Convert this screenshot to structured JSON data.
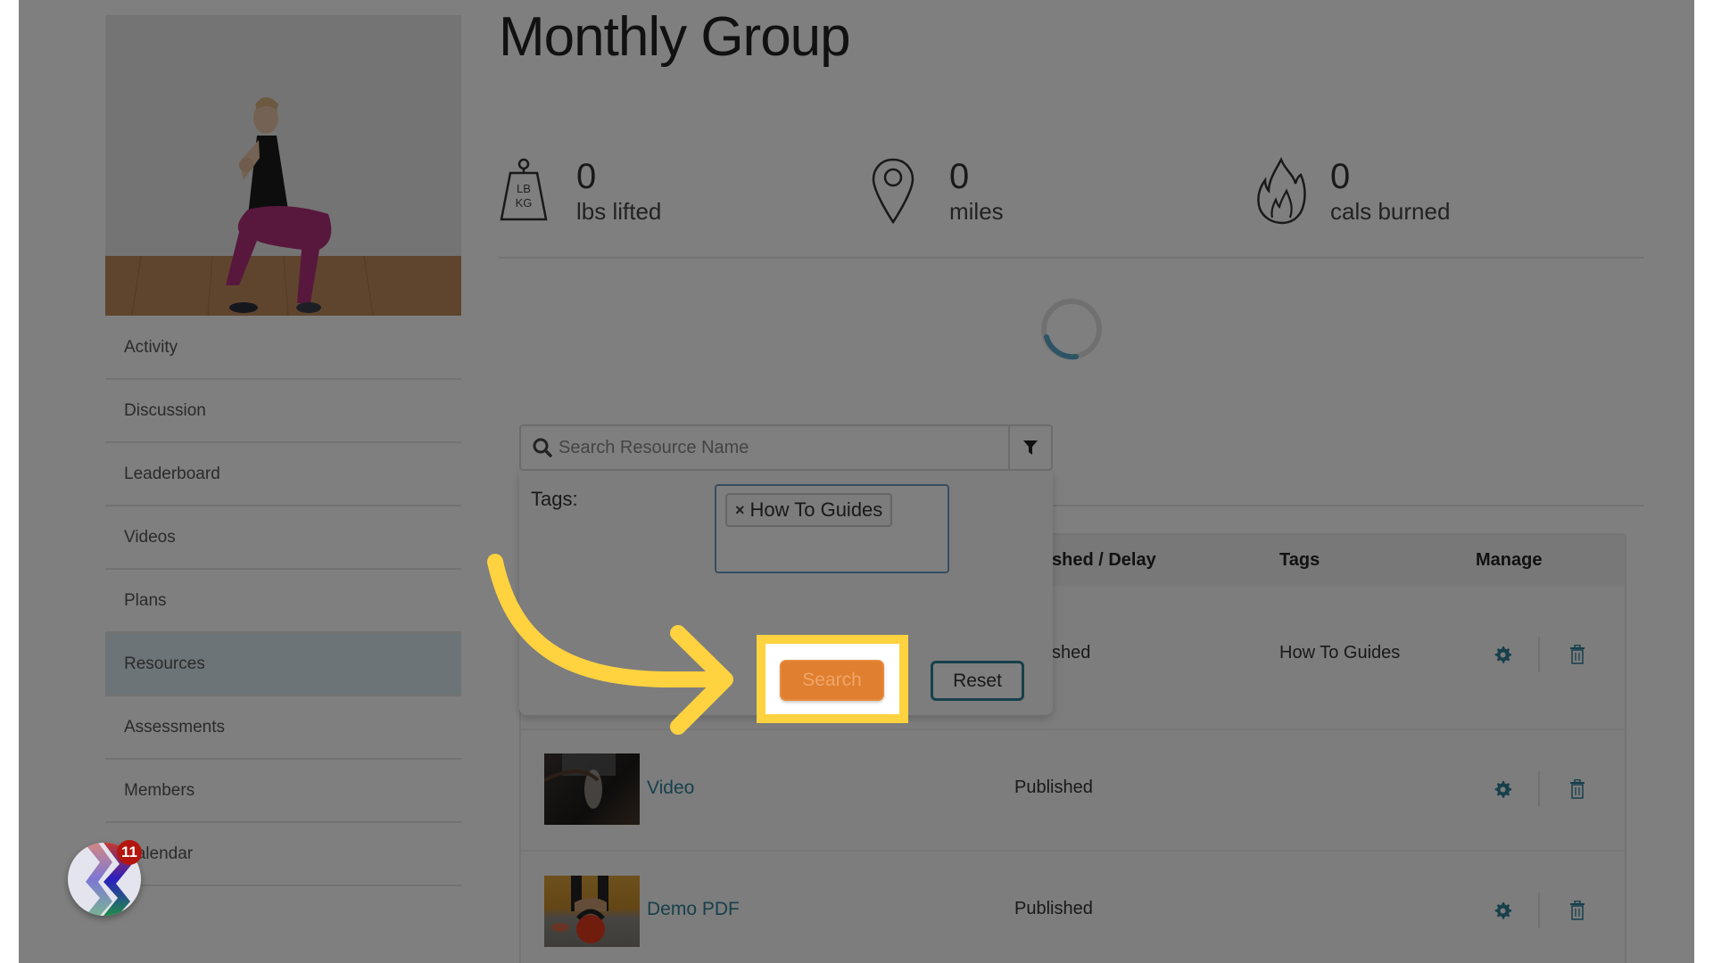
{
  "page": {
    "title": "Monthly Group"
  },
  "sidebar": {
    "items": [
      {
        "label": "Activity",
        "active": false
      },
      {
        "label": "Discussion",
        "active": false
      },
      {
        "label": "Leaderboard",
        "active": false
      },
      {
        "label": "Videos",
        "active": false
      },
      {
        "label": "Plans",
        "active": false
      },
      {
        "label": "Resources",
        "active": true
      },
      {
        "label": "Assessments",
        "active": false
      },
      {
        "label": "Members",
        "active": false
      },
      {
        "label": "Calendar",
        "active": false
      }
    ]
  },
  "stats": [
    {
      "icon": "weight-icon",
      "icon_text_top": "LB",
      "icon_text_bottom": "KG",
      "value": "0",
      "label": "lbs lifted"
    },
    {
      "icon": "map-pin-icon",
      "value": "0",
      "label": "miles"
    },
    {
      "icon": "flame-icon",
      "value": "0",
      "label": "cals burned"
    }
  ],
  "search": {
    "placeholder": "Search Resource Name",
    "value": ""
  },
  "filter_panel": {
    "tags_label": "Tags:",
    "selected_tags": [
      "How To Guides"
    ],
    "remove_glyph": "×",
    "search_label": "Search",
    "reset_label": "Reset"
  },
  "table": {
    "columns": [
      "shed / Delay",
      "Tags",
      "Manage"
    ],
    "rows": [
      {
        "name": "",
        "status": "shed",
        "tags": "How To Guides"
      },
      {
        "name": "Video",
        "status": "Published",
        "tags": ""
      },
      {
        "name": "Demo PDF",
        "status": "Published",
        "tags": ""
      }
    ]
  },
  "widget": {
    "badge_count": "11"
  },
  "colors": {
    "accent": "#2e8097",
    "search_button": "#df7f2f",
    "highlight": "#ffd23f",
    "active_sidebar": "#dbe8ee",
    "badge": "#b3160f"
  }
}
